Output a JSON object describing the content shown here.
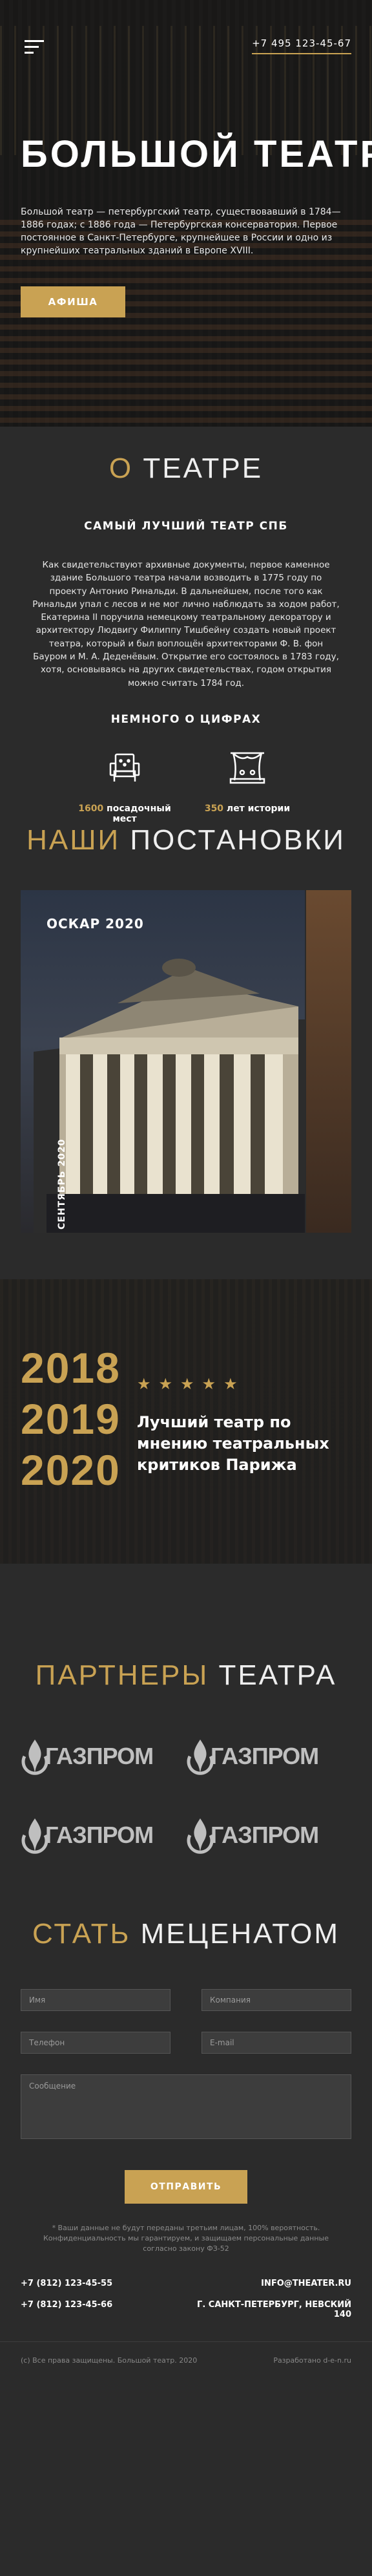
{
  "hero": {
    "phone": "+7 495 123-45-67",
    "title": "БОЛЬШОЙ ТЕАТР",
    "text": "Большой театр — петербургский театр, существовавший в 1784—1886 годах; с 1886 года — Петербургская консерватория. Первое постоянное в Санкт-Петербурге, крупнейшее в России и одно из крупнейших театральных зданий в Европе XVIII.",
    "button": "АФИША",
    "icons": [
      "menu-icon"
    ]
  },
  "about": {
    "title_accent": "О",
    "title_rest": " ТЕАТРЕ",
    "subtitle": "САМЫЙ ЛУЧШИЙ ТЕАТР СПБ",
    "text": "Как свидетельствуют архивные документы, первое каменное здание Большого театра начали возводить в 1775 году по проекту Антонио Ринальди. В дальнейшем, после того как Ринальди упал с лесов и не мог лично наблюдать за ходом работ, Екатерина II поручила немецкому театральному декоратору и архитектору Людвигу Филиппу Тишбейну создать новый проект театра, который и был воплощён архитекторами Ф. В. фон Бауром и М. А. Деденёвым. Открытие его состоялось в 1783 году, хотя, основываясь на других свидетельствах, годом открытия можно считать 1784 год.",
    "numbers_title": "НЕМНОГО О ЦИФРАХ",
    "stats": [
      {
        "value": "1600",
        "label": " посадочный мест",
        "icon": "armchair-icon"
      },
      {
        "value": "350",
        "label": " лет истории",
        "icon": "stage-icon"
      }
    ]
  },
  "productions": {
    "title_accent": "НАШИ",
    "title_rest": " ПОСТАНОВКИ",
    "card_label": "ОСКАР 2020",
    "card_date": "СЕНТЯБРЬ 2020"
  },
  "award": {
    "years": [
      "2018",
      "2019",
      "2020"
    ],
    "stars": "★★★★★",
    "caption": "Лучший театр по мнению театральных критиков Парижа"
  },
  "partners": {
    "title_accent": "ПАРТНЕРЫ",
    "title_rest": " ТЕАТРА",
    "logos": [
      "ГАЗПРОМ",
      "ГАЗПРОМ",
      "ГАЗПРОМ",
      "ГАЗПРОМ"
    ]
  },
  "patron": {
    "title_accent": "СТАТЬ",
    "title_rest": " МЕЦЕНАТОМ",
    "placeholders": {
      "name": "Имя",
      "company": "Компания",
      "phone": "Телефон",
      "email": "E-mail",
      "message": "Сообщение"
    },
    "submit": "ОТПРАВИТЬ",
    "disclaimer": "* Ваши данные не будут переданы третьим лицам, 100% вероятность. Конфиденциальность мы гарантируем, и защищаем персональные данные согласно закону ФЗ-52"
  },
  "contacts": {
    "phone1": "+7 (812) 123-45-55",
    "email": "INFO@THEATER.RU",
    "phone2": "+7 (812) 123-45-66",
    "address": "Г. САНКТ-ПЕТЕРБУРГ, НЕВСКИЙ 140"
  },
  "footer": {
    "copyright": "(c) Все права защищены. Большой театр. 2020",
    "developer": "Разработано d-e-n.ru"
  },
  "colors": {
    "accent": "#c9a253",
    "background": "#2b2b2b"
  }
}
